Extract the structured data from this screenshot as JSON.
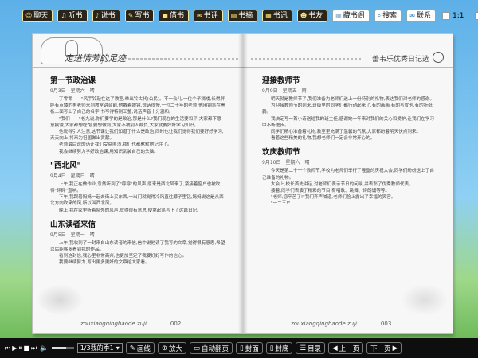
{
  "toolbar": {
    "buttons": [
      {
        "label": "聊天",
        "icon": "chat-icon"
      },
      {
        "label": "听书",
        "icon": "headphones-icon"
      },
      {
        "label": "说书",
        "icon": "microphone-icon"
      },
      {
        "label": "写书",
        "icon": "pen-icon"
      },
      {
        "label": "借书",
        "icon": "book-icon"
      },
      {
        "label": "书评",
        "icon": "comment-icon"
      },
      {
        "label": "书摘",
        "icon": "bookmark-icon"
      },
      {
        "label": "书讯",
        "icon": "news-icon"
      },
      {
        "label": "书友",
        "icon": "friends-icon"
      }
    ],
    "light_buttons": [
      {
        "label": "藏书阁",
        "icon": "library-icon"
      },
      {
        "label": "搜索",
        "icon": "search-icon"
      },
      {
        "label": "联系",
        "icon": "mail-icon"
      }
    ],
    "page_ratio": "1:1",
    "close_label": "关闭"
  },
  "book": {
    "left_header": "走进情芳的足迹",
    "right_header": "蕾韦乐优秀日记选",
    "left_footer": "zouxiangqinghaode.zuji",
    "left_page_number": "002",
    "right_footer": "zouxiangqinghaode.zuji",
    "right_page_number": "003",
    "left_articles": [
      {
        "title": "第一节政治课",
        "date": "9月3日",
        "weather": "星期六",
        "weather2": "晴",
        "paragraphs": [
          "丁零零——\"风手铃敲在这了教室,举出铃古代(公民)。不一会儿,一位个子稍矮,长得胖胖有点矮的男老师来到教室讲台前,他戴着眼镜,说话很慢,一位二十年的老师,他用钢笔在黑板上面写上了自己的名字,书写得特别工整,说话声音十分温和。",
          "\"我们——\"老九说,你们要学的是政治,那是什么?我们现在的生活要和平,大家都不愿意挨饿,大家都想吃饱,要想做到,大家不被别人欺负,大家就要好好学习知识。",
          "他说得引人注意,这节课让我们知道了什么是政治,同时也让我们觉得我们要好好学习,天天向上,将来为祖国做出贡献。",
          "老师最后说的话让我们受益匪浅,我们也都默默地记住了。",
          "我会继续努力学好政治课,用知识武装自己的头脑。"
        ]
      },
      {
        "title": "\"西北风\"",
        "date": "9月4日",
        "weather": "星期日",
        "weather2": "晴",
        "paragraphs": [
          "上午,我正在做作业,忽然听到了\"呼呼\"的风声,原来是西北风来了,紧接着窗户也被吹得\"砰砰\"直响。",
          "下午,我跟着妈妈一起去街上买东西,一出门就觉得冷风直往脖子里钻,妈妈说这是从西北方向吹来的风,所以叫西北风。",
          "晚上,我在家里听着窗外的风声,觉得很有意思,便拿起笔写下了这篇日记。"
        ]
      },
      {
        "title": "山东读者来信",
        "date": "9月5日",
        "weather": "星期一",
        "weather2": "晴",
        "paragraphs": [
          "上午,我收到了一封来自山东读者的来信,信中说他读了我写的文章,觉得很有意思,希望以后能够多看到我的作品。",
          "看到这封信,我心里非常高兴,也更加坚定了我要好好写作的信心。",
          "我要继续努力,写出更多更好的文章给大家看。"
        ]
      }
    ],
    "right_articles": [
      {
        "title": "迎接教师节",
        "date": "9月9日",
        "weather": "星期五",
        "weather2": "雨",
        "paragraphs": [
          "明天就是教师节了,我们准备为老师们送上一份特别的礼物,表达我们对老师的感谢。",
          "为迎接教师节的到来,班级里的同学们都行动起来了,有的画画,有的写贺卡,有的折纸鹤。",
          "我决定写一首小诗送给我的班主任,感谢她一年来对我们的关心和爱护,让我们在学习中不断进步。",
          "同学们精心准备着礼物,教室里充满了温馨的气氛,大家都盼着明天快点到来。",
          "看着这些精美的礼物,我想老师们一定会非常开心的。"
        ]
      },
      {
        "title": "欢庆教师节",
        "date": "9月10日",
        "weather": "星期六",
        "weather2": "晴",
        "paragraphs": [
          "今天是第二十一个教师节,学校为老师们举行了隆重的庆祝大会,同学们纷纷送上了自己准备的礼物。",
          "大会上,校长首先讲话,对老师们表示节日的问候,并表彰了优秀教师代表。",
          "接着,同学们表演了精彩的节目,有唱歌、跳舞、诗朗诵等等。",
          "\"老师,您辛苦了!\"我们齐声喊道,老师们脸上露出了幸福的笑容。",
          "\"一二三!\""
        ]
      }
    ]
  },
  "bottombar": {
    "chapter_select": "1/3我的季1",
    "buttons": [
      {
        "label": "画线",
        "icon": "pencil-icon"
      },
      {
        "label": "放大",
        "icon": "zoom-icon"
      },
      {
        "label": "自动翻页",
        "icon": "auto-flip-icon"
      },
      {
        "label": "封面",
        "icon": "cover-icon"
      },
      {
        "label": "封底",
        "icon": "back-cover-icon"
      },
      {
        "label": "目录",
        "icon": "toc-icon"
      },
      {
        "label": "上一页",
        "icon": "prev-icon"
      },
      {
        "label": "下一页",
        "icon": "next-icon"
      }
    ]
  }
}
